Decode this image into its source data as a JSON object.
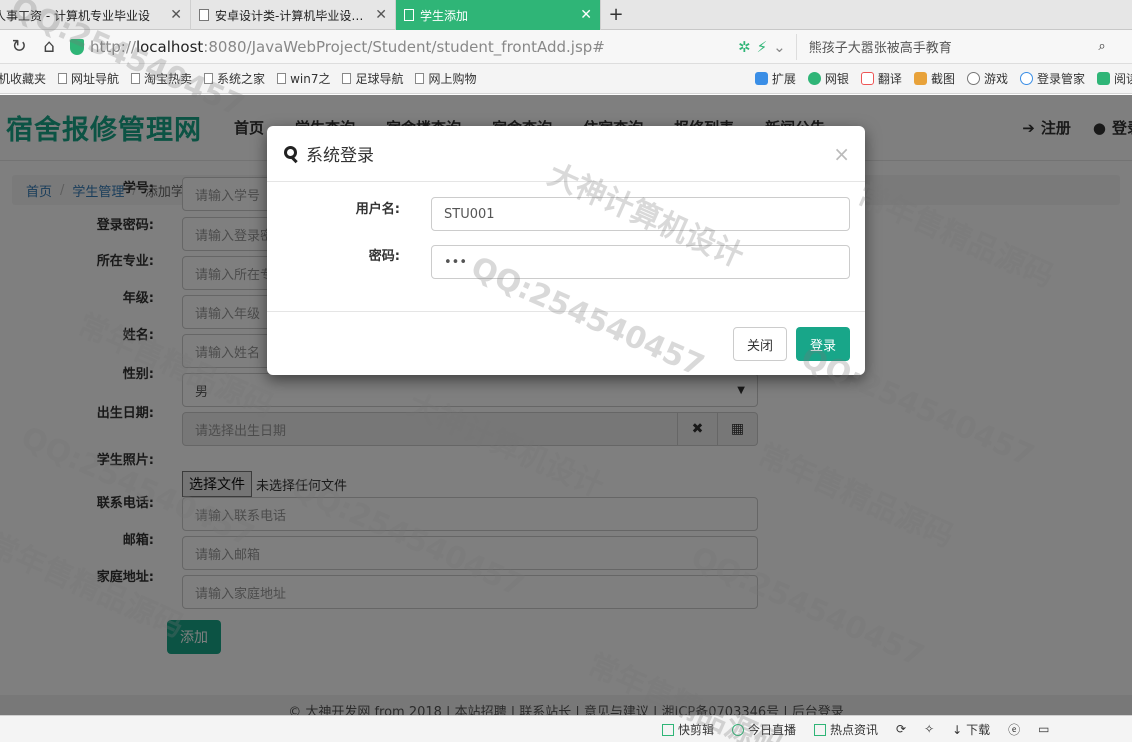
{
  "browser": {
    "tabs": [
      {
        "title": "人事工资 - 计算机专业毕业设",
        "active": false
      },
      {
        "title": "安卓设计类-计算机毕业设计源码",
        "active": false
      },
      {
        "title": "学生添加",
        "active": true
      }
    ],
    "address": {
      "scheme": "http://",
      "host": "localhost",
      "path": ":8080/JavaWebProject/Student/student_frontAdd.jsp#"
    },
    "search_text": "熊孩子大嚣张被高手教育",
    "bookmarks_left": [
      "手机收藏夹",
      "网址导航",
      "淘宝热卖",
      "系统之家",
      "win7之",
      "足球导航",
      "网上购物"
    ],
    "bookmarks_right": [
      "扩展",
      "网银",
      "翻译",
      "截图",
      "游戏",
      "登录管家",
      "阅读"
    ]
  },
  "site": {
    "logo": "宿舍报修管理网",
    "nav": [
      "首页",
      "学生查询",
      "宿舍楼查询",
      "宿舍查询",
      "住宿查询",
      "报修列表",
      "新闻公告"
    ],
    "register": "注册",
    "login": "登录"
  },
  "breadcrumb": {
    "home": "首页",
    "section": "学生管理",
    "current": "添加学生"
  },
  "form": {
    "fields": [
      {
        "label": "学号:",
        "placeholder": "请输入学号"
      },
      {
        "label": "登录密码:",
        "placeholder": "请输入登录密码"
      },
      {
        "label": "所在专业:",
        "placeholder": "请输入所在专业"
      },
      {
        "label": "年级:",
        "placeholder": "请输入年级"
      },
      {
        "label": "姓名:",
        "placeholder": "请输入姓名"
      }
    ],
    "gender_label": "性别:",
    "gender_value": "男",
    "birth_label": "出生日期:",
    "birth_placeholder": "请选择出生日期",
    "photo_label": "学生照片:",
    "photo_button": "选择文件",
    "photo_status": "未选择任何文件",
    "fields2": [
      {
        "label": "联系电话:",
        "placeholder": "请输入联系电话"
      },
      {
        "label": "邮箱:",
        "placeholder": "请输入邮箱"
      },
      {
        "label": "家庭地址:",
        "placeholder": "请输入家庭地址"
      }
    ],
    "submit": "添加"
  },
  "footer": "© 大神开发网 from 2018 | 本站招聘 | 联系站长 | 意见与建议 | 湘ICP备0703346号 | 后台登录",
  "modal": {
    "title": "系统登录",
    "username_label": "用户名:",
    "username_value": "STU001",
    "password_label": "密码:",
    "password_value": "•••",
    "close_button": "关闭",
    "login_button": "登录"
  },
  "statusbar": [
    "快剪辑",
    "今日直播",
    "热点资讯",
    "下载"
  ],
  "watermarks": [
    "常年售精品源码",
    "QQ:254540457",
    "大神计算机设计"
  ]
}
